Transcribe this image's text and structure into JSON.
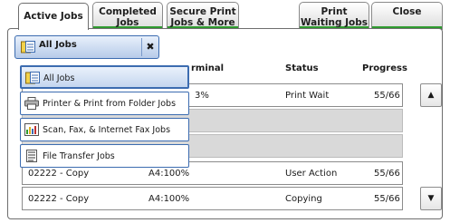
{
  "tabs": [
    {
      "label": "Active Jobs"
    },
    {
      "label": "Completed Jobs"
    },
    {
      "label": "Secure Print Jobs & More"
    },
    {
      "label": "Print Waiting Jobs"
    },
    {
      "label": "Close"
    }
  ],
  "filter": {
    "label": "All Jobs",
    "clear_symbol": "✖"
  },
  "menu": {
    "items": [
      {
        "label": "All Jobs",
        "icon": "all-jobs-icon"
      },
      {
        "label": "Printer & Print from Folder Jobs",
        "icon": "printer-icon"
      },
      {
        "label": "Scan, Fax, & Internet Fax Jobs",
        "icon": "scan-fax-icon"
      },
      {
        "label": "File Transfer Jobs",
        "icon": "file-transfer-icon"
      }
    ]
  },
  "table": {
    "headers": {
      "terminal": "rminal",
      "status": "Status",
      "progress": "Progress"
    },
    "rows": [
      {
        "terminal": "3%",
        "status": "Print Wait",
        "progress": "55/66"
      },
      {
        "owner": "02222 - Copy",
        "terminal": "A4:100%",
        "status": "User Action",
        "progress": "55/66"
      },
      {
        "owner": "02222 - Copy",
        "terminal": "A4:100%",
        "status": "Copying",
        "progress": "55/66"
      }
    ]
  },
  "scroll": {
    "up": "▲",
    "down": "▼"
  }
}
